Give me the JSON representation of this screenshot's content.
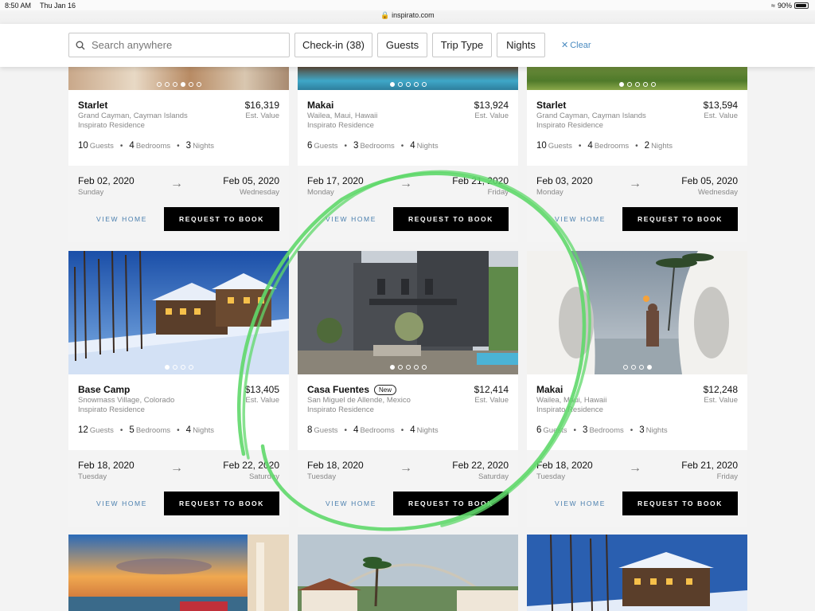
{
  "status": {
    "time": "8:50 AM",
    "date": "Thu Jan 16",
    "url": "inspirato.com",
    "battery": "90%"
  },
  "filters": {
    "search_placeholder": "Search anywhere",
    "checkin": "Check-in (38)",
    "guests": "Guests",
    "trip_type": "Trip Type",
    "nights": "Nights",
    "clear": "Clear"
  },
  "labels": {
    "est_value": "Est. Value",
    "guests": "Guests",
    "bedrooms": "Bedrooms",
    "nights": "Nights",
    "view_home": "VIEW HOME",
    "request": "REQUEST TO BOOK",
    "new_badge": "New"
  },
  "row1": [
    {
      "name": "Starlet",
      "location": "Grand Cayman, Cayman Islands",
      "type": "Inspirato Residence",
      "price": "$16,319",
      "guests": "10",
      "bedrooms": "4",
      "nights": "3",
      "from": "Feb 02, 2020",
      "from_day": "Sunday",
      "to": "Feb 05, 2020",
      "to_day": "Wednesday"
    },
    {
      "name": "Makai",
      "location": "Wailea, Maui, Hawaii",
      "type": "Inspirato Residence",
      "price": "$13,924",
      "guests": "6",
      "bedrooms": "3",
      "nights": "4",
      "from": "Feb 17, 2020",
      "from_day": "Monday",
      "to": "Feb 21, 2020",
      "to_day": "Friday"
    },
    {
      "name": "Starlet",
      "location": "Grand Cayman, Cayman Islands",
      "type": "Inspirato Residence",
      "price": "$13,594",
      "guests": "10",
      "bedrooms": "4",
      "nights": "2",
      "from": "Feb 03, 2020",
      "from_day": "Monday",
      "to": "Feb 05, 2020",
      "to_day": "Wednesday"
    }
  ],
  "row2": [
    {
      "name": "Base Camp",
      "location": "Snowmass Village, Colorado",
      "type": "Inspirato Residence",
      "price": "$13,405",
      "guests": "12",
      "bedrooms": "5",
      "nights": "4",
      "from": "Feb 18, 2020",
      "from_day": "Tuesday",
      "to": "Feb 22, 2020",
      "to_day": "Saturday"
    },
    {
      "name": "Casa Fuentes",
      "location": "San Miguel de Allende, Mexico",
      "type": "Inspirato Residence",
      "price": "$12,414",
      "guests": "8",
      "bedrooms": "4",
      "nights": "4",
      "from": "Feb 18, 2020",
      "from_day": "Tuesday",
      "to": "Feb 22, 2020",
      "to_day": "Saturday"
    },
    {
      "name": "Makai",
      "location": "Wailea, Maui, Hawaii",
      "type": "Inspirato Residence",
      "price": "$12,248",
      "guests": "6",
      "bedrooms": "3",
      "nights": "3",
      "from": "Feb 18, 2020",
      "from_day": "Tuesday",
      "to": "Feb 21, 2020",
      "to_day": "Friday"
    }
  ],
  "colors": {
    "accent_link": "#4a7fae",
    "button_bg": "#000000",
    "annotation": "#5fd86a"
  }
}
